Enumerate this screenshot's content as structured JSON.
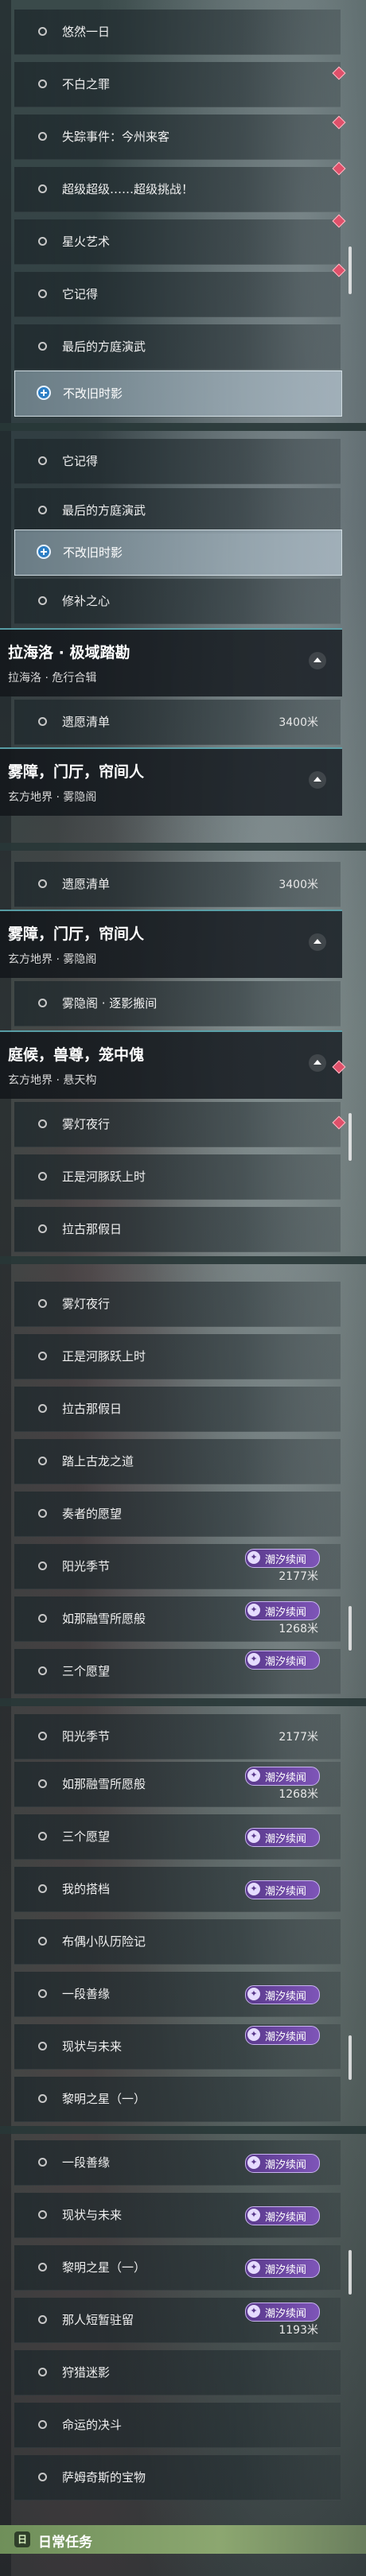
{
  "blocks": {
    "b1": [
      "悠然一日",
      "不白之罪",
      "失踪事件：今州来客",
      "超级超级……超级挑战！",
      "星火艺术",
      "它记得",
      "最后的方庭演武"
    ],
    "b1_selected": "不改旧时影",
    "b2": [
      "它记得",
      "最后的方庭演武"
    ],
    "b2_selected": "不改旧时影",
    "b2_after": "修补之心",
    "sect1": {
      "title": "拉海洛 · 极域踏勘",
      "subtitle": "拉海洛 · 危行合辑"
    },
    "sect1_item": {
      "label": "遗愿清单",
      "distance": "3400米"
    },
    "sect2": {
      "title": "雾障，门厅，帘间人",
      "subtitle": "玄方地界 · 雾隐阁"
    },
    "b4_item": {
      "label": "遗愿清单",
      "distance": "3400米"
    },
    "sect3": {
      "title": "雾障，门厅，帘间人",
      "subtitle": "玄方地界 · 雾隐阁"
    },
    "b4_after": "雾隐阁 · 逐影搬间",
    "sect4": {
      "title": "庭候，兽尊，笼中傀",
      "subtitle": "玄方地界 · 悬天构"
    },
    "b5": [
      "雾灯夜行",
      "正是河豚跃上时",
      "拉古那假日"
    ],
    "b6": [
      "雾灯夜行",
      "正是河豚跃上时",
      "拉古那假日",
      "踏上古龙之道",
      "奏者的愿望"
    ],
    "sunny": {
      "label": "阳光季节",
      "distance": "2177米"
    },
    "as_wish": {
      "label": "如那融雪所愿般",
      "distance": "1268米"
    },
    "three_wishes": "三个愿望",
    "b7_items": [
      "我的搭档",
      "布偶小队历险记",
      "一段善缘",
      "现状与未来",
      "黎明之星（一）"
    ],
    "b8_items": [
      "一段善缘",
      "现状与未来",
      "黎明之星（一）"
    ],
    "bells": {
      "label": "那人短暂驻留",
      "distance": "1193米"
    },
    "b8_after": [
      "狩猎迷影",
      "命运的决斗",
      "萨姆奇斯的宝物"
    ],
    "badge_text": "潮汐续闻",
    "daily": {
      "label": "日常任务",
      "icon": "日"
    }
  }
}
